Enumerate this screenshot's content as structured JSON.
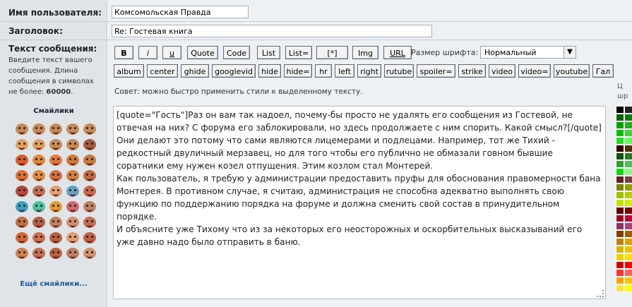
{
  "form": {
    "username_label": "Имя пользователя:",
    "username_value": "Комсомольская Правда",
    "subject_label": "Заголовок:",
    "subject_value": "Re: Гостевая книга",
    "message_label": "Текст сообщения:",
    "message_hint": "Введите текст вашего сообщения. Длина сообщения в символах не более: ",
    "message_limit": "60000",
    "message_hint_end": "."
  },
  "smilies": {
    "title": "Смайлики",
    "more_link": "Ещё смайлики...",
    "colors": [
      "#c58a55",
      "#c58a55",
      "#c58a55",
      "#c58a55",
      "#c58a55",
      "#e0a060",
      "#e0a060",
      "#c58a55",
      "#c58a55",
      "#a35c3a",
      "#d95c2a",
      "#e0883a",
      "#e07a3a",
      "#d0783a",
      "#c87a3a",
      "#e07030",
      "#e08a40",
      "#d07040",
      "#d08040",
      "#c06a40",
      "#b04a3a",
      "#c07050",
      "#e0a070",
      "#6aa0c0",
      "#c86a4a",
      "#3aa0c0",
      "#4ac0a0",
      "#e09a30",
      "#d06a6a",
      "#c08060",
      "#c07040",
      "#b06040",
      "#c08060",
      "#d09070",
      "#c07050",
      "#d06a30",
      "#c87050",
      "#b86040",
      "#e0a070",
      "#c06040",
      "#d08050",
      "#c07050",
      "#b86040",
      "#c08060",
      "#d09070"
    ]
  },
  "toolbar": {
    "row1": [
      {
        "label": "B",
        "style": "b"
      },
      {
        "label": "i",
        "style": "i"
      },
      {
        "label": "u",
        "style": "u"
      },
      {
        "label": "Quote",
        "style": ""
      },
      {
        "label": "Code",
        "style": ""
      },
      {
        "label": "List",
        "style": ""
      },
      {
        "label": "List=",
        "style": ""
      },
      {
        "label": "[*]",
        "style": ""
      },
      {
        "label": "Img",
        "style": ""
      },
      {
        "label": "URL",
        "style": "u"
      }
    ],
    "row2": [
      "album",
      "center",
      "ghide",
      "googlevid",
      "hide",
      "hide=",
      "hr",
      "left",
      "right",
      "rutube",
      "spoiler=",
      "strike",
      "video",
      "video=",
      "youtube",
      "Гал"
    ],
    "font_size_label": "Размер шрифта:",
    "font_size_value": "Нормальный"
  },
  "tip": "Совет: можно быстро применить стили к выделенному тексту.",
  "message_body": [
    "[quote=\"Гость\"]Раз он вам так надоел, почему-бы просто не удалять его сообщения из Гостевой, не отвечая на них? С форума его заблокировали, но здесь продолжаете с ним спорить. Какой смысл?[/quote]",
    "Они делают это потому что сами являются лицемерами и подлецами. Например, тот же Тихий - редкостный двуличный мерзавец, но для того чтобы его публично не обмазали говном бывшие соратники ему нужен козел отпущения. Этим козлом стал Монтерей.",
    "Как пользователь, я требую у администрации предоставить пруфы для обоснования правомерности бана Монтерея. В противном случае, я считаю, администрация не способна адекватно выполнять свою функцию по поддержанию порядка на форуме и должна сменить свой состав в принудительном порядке.",
    "И объясните уже Тихому что из за некоторых его неосторожных и оскорбительных высказываний его уже давно надо было отправить в баню."
  ],
  "palette": {
    "label_line1": "Ц",
    "label_line2": "шр",
    "colors": [
      "#000000",
      "#222222",
      "#006400",
      "#008000",
      "#00a000",
      "#20b020",
      "#00c000",
      "#40d040",
      "#20e020",
      "#60ff60",
      "#300000",
      "#503000",
      "#105010",
      "#208020",
      "#30a030",
      "#50c050",
      "#00e000",
      "#80ff80",
      "#602020",
      "#804040",
      "#808000",
      "#90a000",
      "#a0c000",
      "#b0d000",
      "#c0e000",
      "#d0f000",
      "#600000",
      "#800000",
      "#a00020",
      "#c00030",
      "#903060",
      "#b04080",
      "#804000",
      "#a06000",
      "#c08000",
      "#e0a000",
      "#e0b000",
      "#f0c000",
      "#f0d000",
      "#ffe000",
      "#cc0000",
      "#ff0000",
      "#ff3030",
      "#ff6060",
      "#ffa000",
      "#ffc000",
      "#ffe040",
      "#ffff00"
    ]
  }
}
